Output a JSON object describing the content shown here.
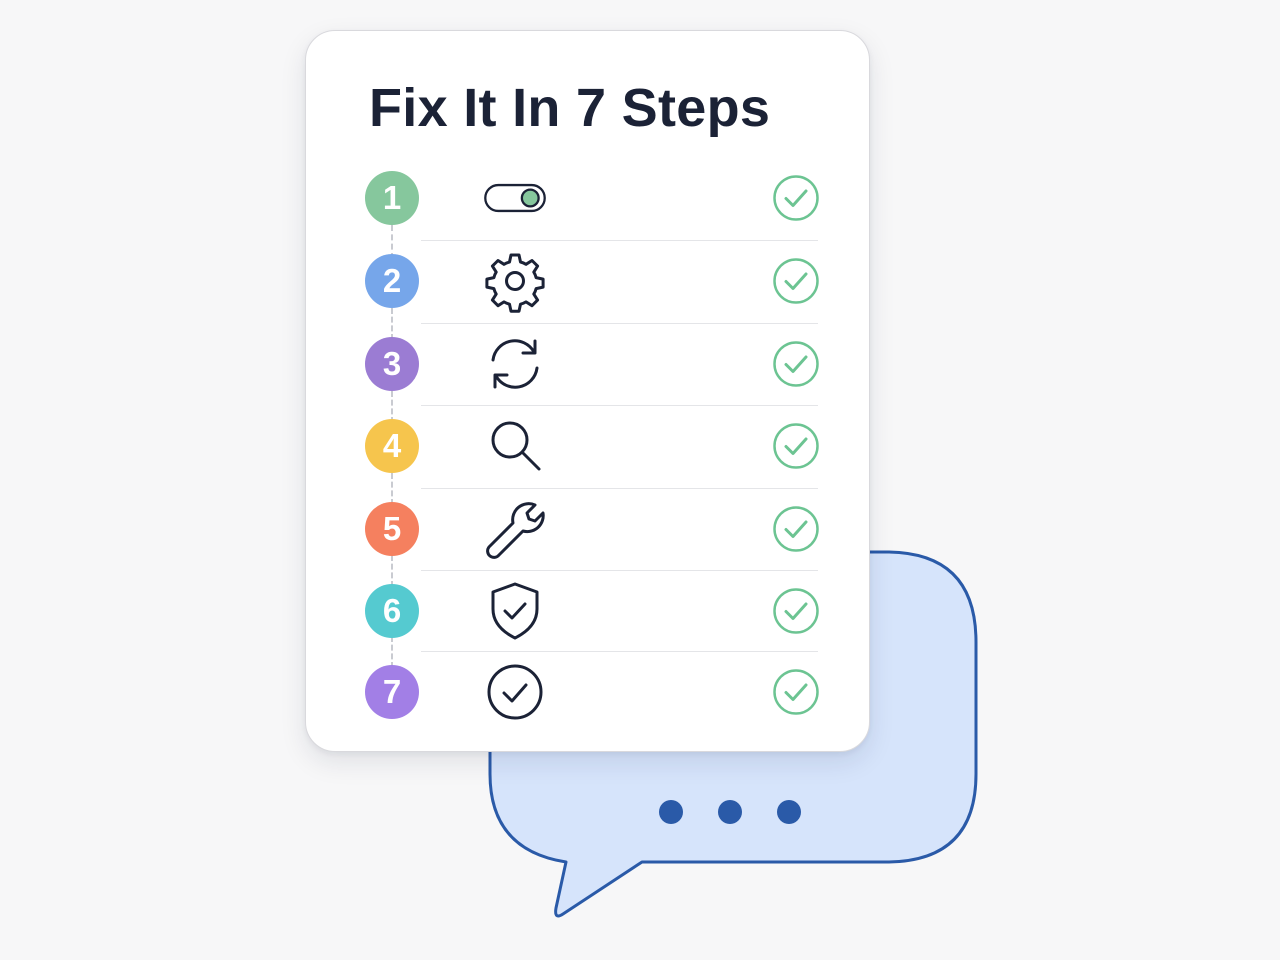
{
  "title": "Fix It In 7 Steps",
  "colors": {
    "title_text": "#1b2236",
    "check_green": "#6cc492",
    "bubble_fill": "#d6e4fb",
    "bubble_stroke": "#2a5aa8",
    "icon_stroke": "#1b2236"
  },
  "steps": [
    {
      "number": "1",
      "color": "#86c79d",
      "icon": "toggle-icon"
    },
    {
      "number": "2",
      "color": "#76a6ea",
      "icon": "gear-icon"
    },
    {
      "number": "3",
      "color": "#9b7cd3",
      "icon": "refresh-icon"
    },
    {
      "number": "4",
      "color": "#f6c54d",
      "icon": "search-icon"
    },
    {
      "number": "5",
      "color": "#f5805f",
      "icon": "wrench-icon"
    },
    {
      "number": "6",
      "color": "#55cad0",
      "icon": "shield-check-icon"
    },
    {
      "number": "7",
      "color": "#a27fe6",
      "icon": "check-circle-icon"
    }
  ],
  "chat_bubble": {
    "icon": "typing-indicator-icon",
    "dots": 3
  }
}
